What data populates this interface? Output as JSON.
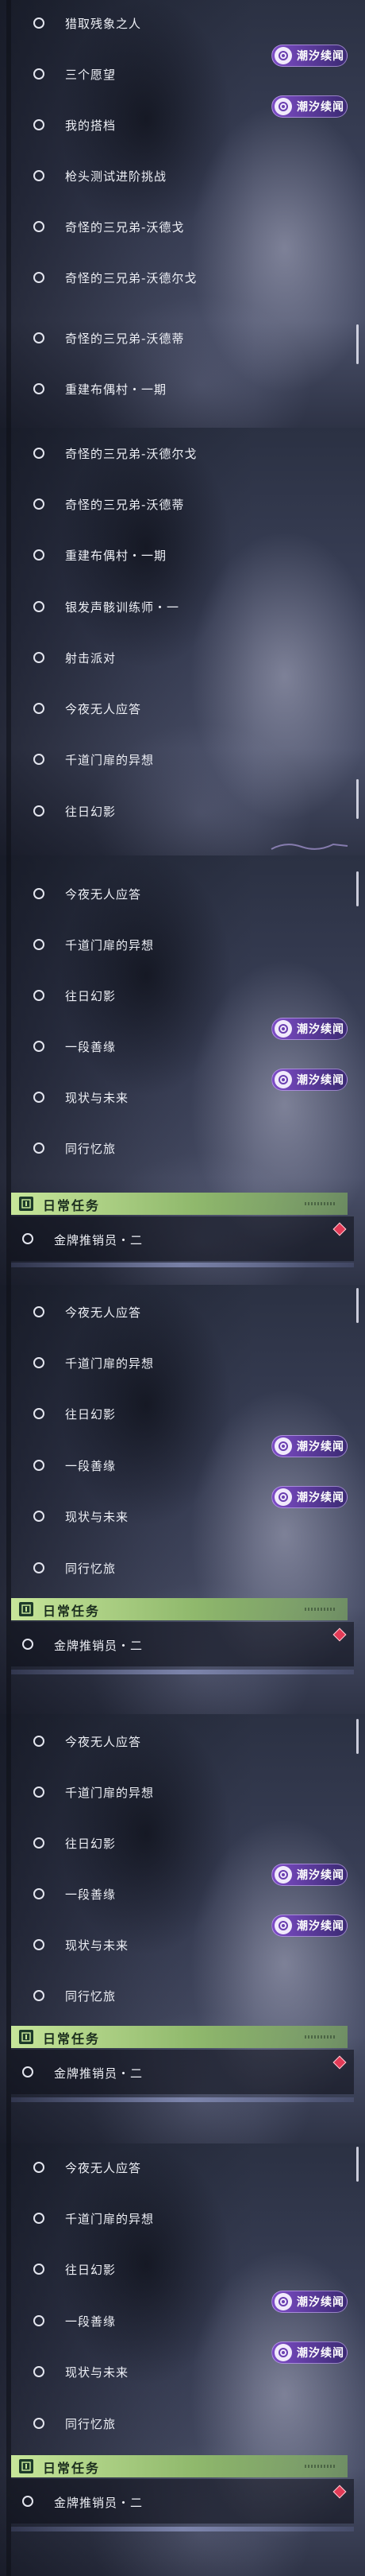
{
  "badge_label": "潮汐续闻",
  "daily": {
    "header": "日常任务",
    "item": "金牌推销员・二"
  },
  "panels": [
    {
      "items": [
        "猎取残象之人",
        "三个愿望",
        "我的搭档",
        "枪头测试进阶挑战",
        "奇怪的三兄弟-沃德戈",
        "奇怪的三兄弟-沃德尔戈",
        "奇怪的三兄弟-沃德蒂",
        "重建布偶村・一期"
      ]
    },
    {
      "items": [
        "奇怪的三兄弟-沃德尔戈",
        "奇怪的三兄弟-沃德蒂",
        "重建布偶村・一期",
        "银发声骸训练师・一",
        "射击派对",
        "今夜无人应答",
        "千道门扉的异想",
        "往日幻影"
      ]
    },
    {
      "items": [
        "今夜无人应答",
        "千道门扉的异想",
        "往日幻影",
        "一段善缘",
        "现状与未来",
        "同行忆旅"
      ]
    },
    {
      "items": [
        "今夜无人应答",
        "千道门扉的异想",
        "往日幻影",
        "一段善缘",
        "现状与未来",
        "同行忆旅"
      ]
    },
    {
      "items": [
        "今夜无人应答",
        "千道门扉的异想",
        "往日幻影",
        "一段善缘",
        "现状与未来",
        "同行忆旅"
      ]
    },
    {
      "items": [
        "今夜无人应答",
        "千道门扉的异想",
        "往日幻影",
        "一段善缘",
        "现状与未来",
        "同行忆旅"
      ]
    }
  ],
  "colors": {
    "badge_purple": "#7d4cc6",
    "daily_green": "#b5d98c",
    "diamond_red": "#e23a56"
  }
}
